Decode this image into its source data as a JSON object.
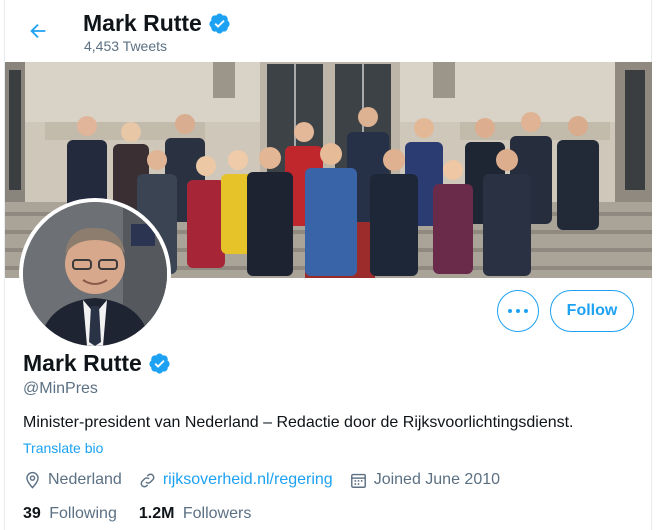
{
  "header": {
    "name": "Mark Rutte",
    "tweet_count": "4,453 Tweets"
  },
  "profile": {
    "name": "Mark Rutte",
    "handle": "@MinPres",
    "bio": "Minister-president van Nederland – Redactie door de Rijksvoorlichtingsdienst.",
    "translate_label": "Translate bio",
    "location": "Nederland",
    "website": "rijksoverheid.nl/regering",
    "joined": "Joined June 2010",
    "following_count": "39",
    "following_label": "Following",
    "followers_count": "1.2M",
    "followers_label": "Followers"
  },
  "actions": {
    "follow_label": "Follow"
  },
  "colors": {
    "accent": "#1da1f2",
    "secondary_text": "#5b7083"
  },
  "icons": [
    "back-arrow-icon",
    "verified-badge-icon",
    "more-icon",
    "location-icon",
    "link-icon",
    "calendar-icon"
  ]
}
